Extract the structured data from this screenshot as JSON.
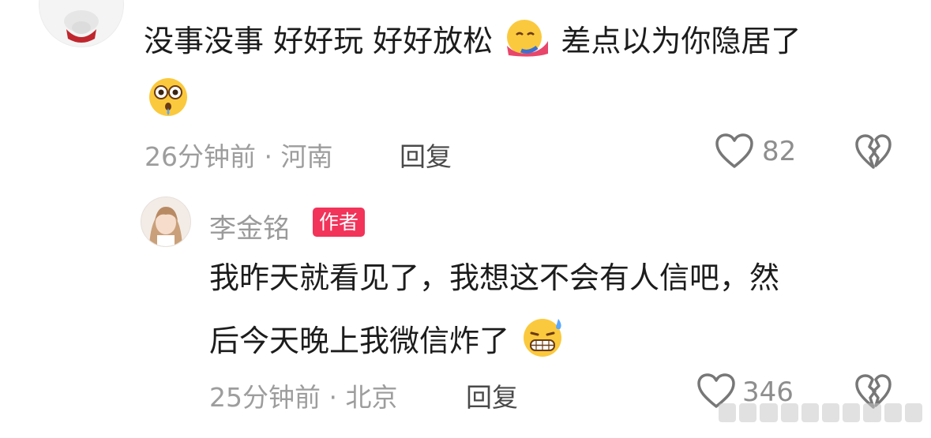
{
  "comments": [
    {
      "text_part1": "没事没事 好好玩 好好放松",
      "text_part2": "差点以为你隐居了",
      "emoji1": "hugging-face",
      "emoji2": "flushed-face",
      "time": "26分钟前 · 河南",
      "reply": "回复",
      "likes": "82"
    },
    {
      "username": "李金铭",
      "badge": "作者",
      "text_line1": "我昨天就看见了，我想这不会有人信吧，然",
      "text_line2": "后今天晚上我微信炸了",
      "emoji": "grinning-sweat-face",
      "time": "25分钟前 · 北京",
      "reply": "回复",
      "likes": "346"
    }
  ],
  "colors": {
    "badge": "#f2335a",
    "meta_text": "#9d9d9d",
    "body_text": "#1c1c1c"
  }
}
